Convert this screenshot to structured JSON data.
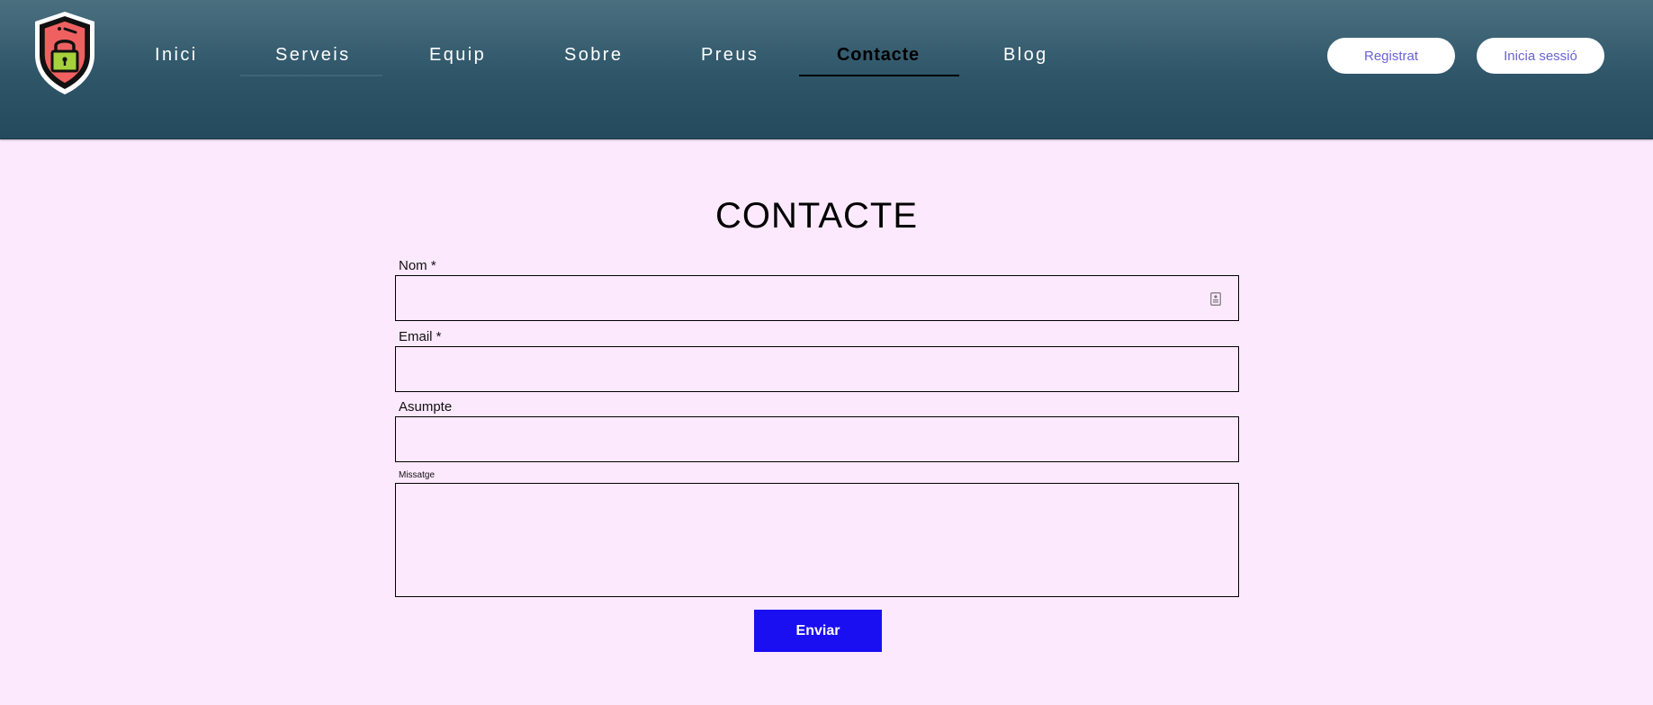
{
  "header": {
    "logo_icon": "shield-lock-icon",
    "nav": [
      {
        "label": "Inici"
      },
      {
        "label": "Serveis"
      },
      {
        "label": "Equip"
      },
      {
        "label": "Sobre"
      },
      {
        "label": "Preus"
      },
      {
        "label": "Contacte",
        "active": true
      },
      {
        "label": "Blog"
      }
    ],
    "signup_label": "Registrat",
    "login_label": "Inicia sessió"
  },
  "page": {
    "title": "CONTACTE"
  },
  "form": {
    "name_label": "Nom *",
    "email_label": "Email *",
    "subject_label": "Asumpte",
    "message_label": "Missatge",
    "name_value": "",
    "email_value": "",
    "subject_value": "",
    "message_value": "",
    "submit_label": "Enviar",
    "autofill_icon": "contact-card-icon"
  },
  "colors": {
    "page_background": "#fde9fe",
    "header_gradient_top": "#4a7080",
    "header_gradient_bottom": "#244a5d",
    "accent_button": "#1a0ff0",
    "pill_button_text": "#6a63d6"
  }
}
